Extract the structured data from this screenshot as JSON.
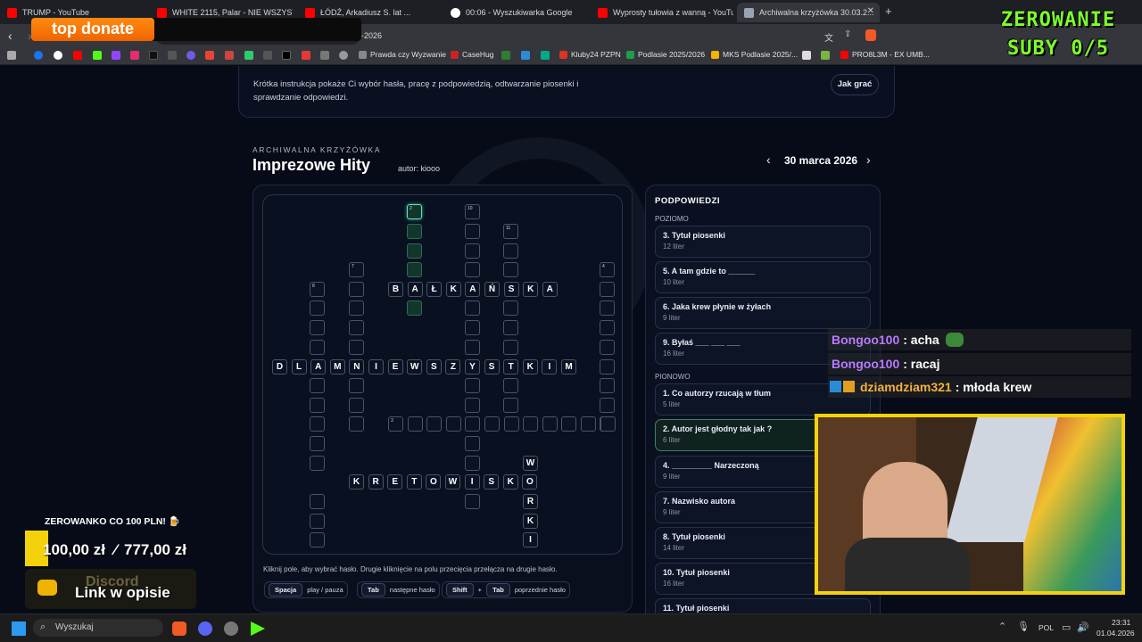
{
  "browser": {
    "tabs": [
      {
        "title": "TRUMP - YouTube"
      },
      {
        "title": "WHITE 2115, Palar - NIE WSZYSTKO ..."
      },
      {
        "title": "ŁÓDŹ, Arkadiusz S. lat ..."
      },
      {
        "title": "00:06 - Wyszukiwarka Google"
      },
      {
        "title": "Wyprosty tułowia z wanną - YouTube"
      },
      {
        "title": "Archiwalna krzyżówka 30.03.2..."
      }
    ],
    "address_fragment": "-2026",
    "bookmarks": [
      "Prawda czy Wyzwanie",
      "CaseHug",
      "Kluby24 PZPN",
      "Podlasie 2025/2026",
      "MKS Podlasie 2025/...",
      "PRO8L3M - EX UMB..."
    ]
  },
  "overlay": {
    "top_donate": "top donate",
    "zerowanie_line1": "ZEROWANIE",
    "zerowanie_line2": "SUBY 0/5",
    "promo": "ZEROWANKO CO 100 PLN! 🍺",
    "goal_current": "100,00 zł",
    "goal_sep": "⁄",
    "goal_target": "777,00 zł",
    "discord_ghost": "Discord",
    "discord_link": "Link w opisie"
  },
  "chat": [
    {
      "user": "Bongoo100",
      "message": ": acha",
      "color": "#b67bff"
    },
    {
      "user": "Bongoo100",
      "message": ": racaj",
      "color": "#b67bff"
    },
    {
      "user": "dziamdziam321",
      "message": ": młoda krew",
      "color": "#f3b23a"
    }
  ],
  "howto": {
    "text": "Krótka instrukcja pokaże Ci wybór hasła, pracę z podpowiedzią, odtwarzanie piosenki i sprawdzanie odpowiedzi.",
    "button": "Jak grać"
  },
  "puzzle": {
    "kicker": "ARCHIWALNA KRZYŻÓWKA",
    "title": "Imprezowe Hity",
    "author": "autor: kiooo",
    "date": "30 marca 2026",
    "prev": "‹",
    "next": "›"
  },
  "clues": {
    "header": "PODPOWIEDZI",
    "across_label": "POZIOMO",
    "down_label": "PIONOWO",
    "across": [
      {
        "title": "3. Tytuł piosenki",
        "sub": "12 liter"
      },
      {
        "title": "5. A tam gdzie to ______",
        "sub": "10 liter"
      },
      {
        "title": "6. Jaka krew płynie w żyłach",
        "sub": "9 liter"
      },
      {
        "title": "9. Byłaś ___ ___ ___",
        "sub": "16 liter"
      }
    ],
    "down": [
      {
        "title": "1. Co autorzy rzucają w tłum",
        "sub": "5 liter"
      },
      {
        "title": "2. Autor jest głodny tak jak ?",
        "sub": "6 liter"
      },
      {
        "title": "4. _________ Narzeczoną",
        "sub": "9 liter"
      },
      {
        "title": "7. Nazwisko autora",
        "sub": "9 liter"
      },
      {
        "title": "8. Tytuł piosenki",
        "sub": "14 liter"
      },
      {
        "title": "10. Tytuł piosenki",
        "sub": "16 liter"
      },
      {
        "title": "11. Tytuł piosenki",
        "sub": ""
      }
    ]
  },
  "help": {
    "text": "Kliknij pole, aby wybrać hasło. Drugie kliknięcie na polu przecięcia przełącza na drugie hasło.",
    "key_space": "Spacja",
    "play": "play / pauza",
    "key_tab": "Tab",
    "next_clue": "następne hasło",
    "key_shift": "Shift",
    "plus": "+",
    "key_tab2": "Tab",
    "prev_clue": "poprzednie hasło"
  },
  "taskbar": {
    "search": "Wyszukaj",
    "lang": "POL",
    "time": "23:31",
    "date": "01.04.2026"
  },
  "colors": {
    "page_bg": "#070b18",
    "accent_green": "#6fe0b8",
    "overlay_orange": "#ff7a00",
    "overlay_green": "#7dff2a",
    "overlay_yellow": "#f4d20b"
  }
}
